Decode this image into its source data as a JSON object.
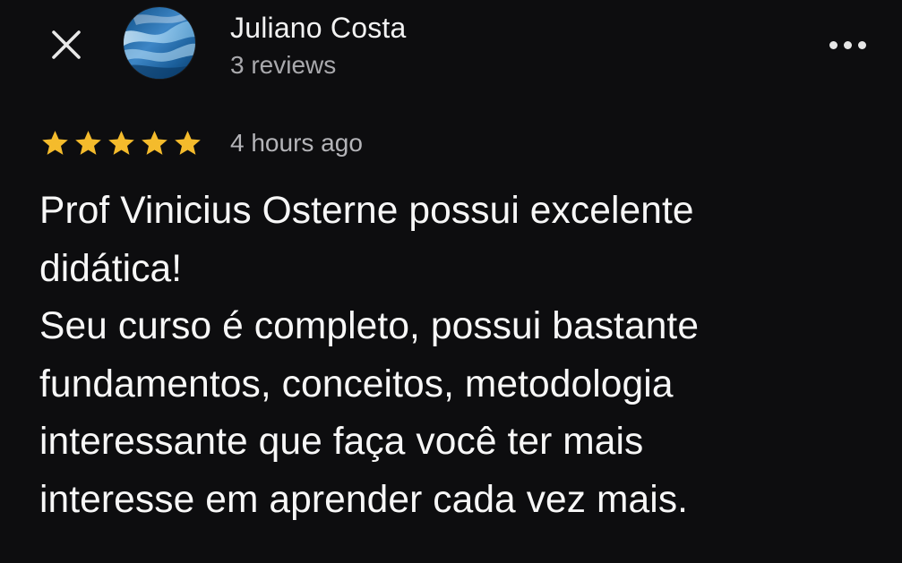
{
  "header": {
    "close_icon": "close-icon",
    "user_name": "Juliano Costa",
    "review_count": "3 reviews",
    "more_icon": "more-horizontal-icon"
  },
  "review": {
    "rating": 5,
    "rating_max": 5,
    "star_color": "#f4bb2c",
    "timestamp": "4 hours ago",
    "lines": [
      "Prof Vinicius Osterne possui excelente",
      "didática!",
      "Seu curso é completo, possui bastante",
      "fundamentos, conceitos, metodologia",
      "interessante que faça você ter mais",
      "interesse em aprender cada vez mais."
    ]
  },
  "colors": {
    "background": "#0d0d0f",
    "primary_text": "#f7f7f7",
    "secondary_text": "#a9a9ad"
  }
}
